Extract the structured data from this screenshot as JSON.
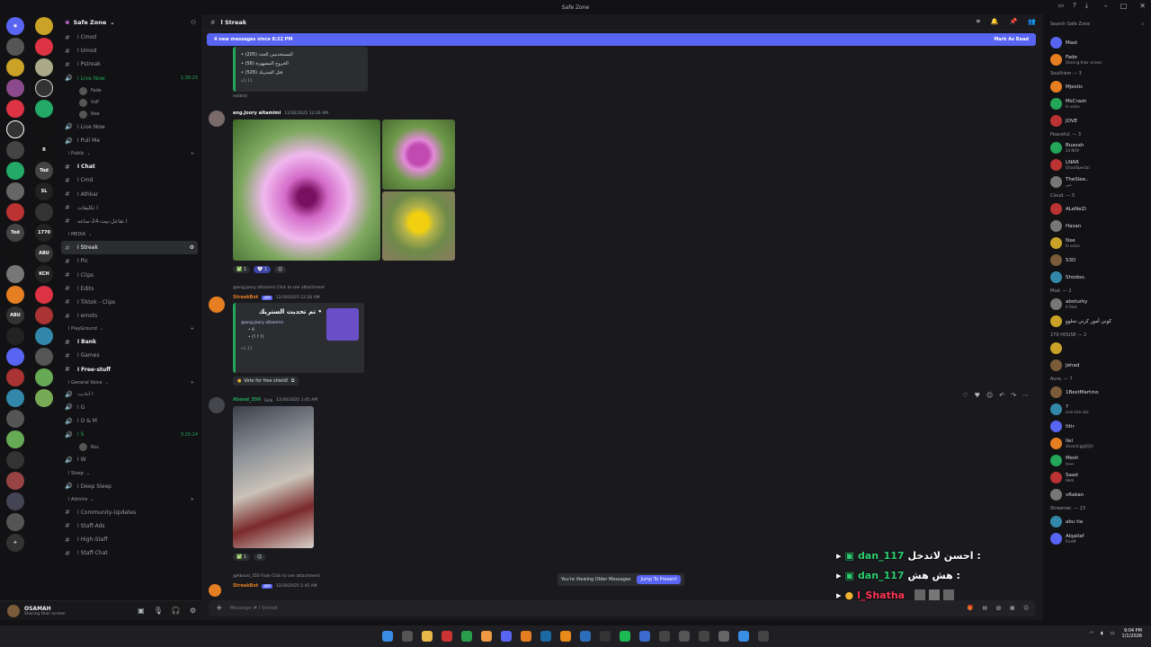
{
  "app": {
    "title": "Safe Zone"
  },
  "server": {
    "name": "Safe Zone"
  },
  "channels": {
    "top": [
      {
        "label": "ا Cmod"
      },
      {
        "label": "ا Umod"
      },
      {
        "label": "ا Pstreak"
      }
    ],
    "live": {
      "label": "ا Live Now",
      "time": "1:38:25",
      "users": [
        {
          "name": "Fade"
        },
        {
          "name": "VsP"
        },
        {
          "name": "Nxe"
        }
      ]
    },
    "after_live": [
      {
        "label": "ا Live Now"
      },
      {
        "label": "ا Pull Me"
      }
    ],
    "public": {
      "label": "ا Public",
      "items": [
        {
          "label": "ا Chat"
        },
        {
          "label": "ا Cmd"
        },
        {
          "label": "ا Athkar"
        },
        {
          "label": "ا تكليفات"
        },
        {
          "label": "ا تفاعل-بيت-24-ساعه"
        }
      ]
    },
    "media": {
      "label": "ا MEDIA",
      "items": [
        {
          "label": "ا Streak"
        },
        {
          "label": "ا Pic"
        },
        {
          "label": "ا Clips"
        },
        {
          "label": "ا Edits"
        },
        {
          "label": "ا Tiktok - Clips"
        },
        {
          "label": "ا emots"
        }
      ]
    },
    "playground": {
      "label": "ا PlayGround",
      "items": [
        {
          "label": "ا Bank"
        },
        {
          "label": "ا Games"
        },
        {
          "label": "ا Free-stuff"
        }
      ]
    },
    "general_voice": {
      "label": "ا General Voice",
      "items": [
        {
          "label": "ا آحاديث"
        },
        {
          "label": "ا G"
        },
        {
          "label": "ا O & M"
        },
        {
          "label": "ا S"
        },
        {
          "label": "ا W"
        }
      ],
      "s_time": "3:25:24",
      "s_user": "Ros"
    },
    "sleep": {
      "label": "ا Sleep",
      "items": [
        {
          "label": "ا Deep Sleep"
        }
      ]
    },
    "admins": {
      "label": "ا Admins",
      "items": [
        {
          "label": "ا Community-Updates"
        },
        {
          "label": "ا Staff-Ads"
        },
        {
          "label": "ا High-Staff"
        },
        {
          "label": "ا Staff-Chat"
        }
      ]
    }
  },
  "user": {
    "name": "OSAMAH",
    "status": "Sharing their screen"
  },
  "header": {
    "channel": "ا Streak"
  },
  "banner": {
    "text": "4 new messages since 8:22 PM",
    "action": "Mark As Read"
  },
  "messages": {
    "m0": {
      "lines": [
        "• (205) المستخدمين الجدد",
        "• (56) الخروج المشهورة",
        "• (526) قتل الستريك"
      ],
      "footer": "v1.11",
      "edited": "(edited)"
    },
    "m1": {
      "author": "eng.Joory altamimi",
      "time": "12/30/2025 12:26 AM",
      "reactions": [
        "✅ 1",
        "🤍 1"
      ]
    },
    "m2": {
      "reply": "@eng.Joory altamimi Click to see attachment",
      "author": "StreakBot",
      "badge": "APP",
      "time": "12/30/2025 12:26 AM",
      "embed_title": "تم تحديث الستريك •",
      "embed_user": "@eng.Joory altamimi",
      "embed_lines": [
        "• 6",
        "• (؟ ؟ ؟)"
      ],
      "embed_footer": "v1.11",
      "vote": "Vote for free shield!"
    },
    "m3": {
      "author": "Abood_350",
      "tag": "Fade",
      "time": "12/30/2025 1:45 AM",
      "reactions": [
        "✅ 1"
      ]
    },
    "m4": {
      "reply": "@Abood_350 Fade Click to see attachment",
      "author": "StreakBot",
      "badge": "APP",
      "time": "12/30/2025 1:45 AM"
    }
  },
  "older": {
    "text": "You're Viewing Older Messages",
    "button": "Jump To Present"
  },
  "composer": {
    "placeholder": "Message # ا Streak"
  },
  "overlay": [
    {
      "name": "dan_117",
      "text": "احسن لاتدخل :"
    },
    {
      "name": "dan_117",
      "text": "هش هش :"
    },
    {
      "name": "l_Shatha",
      "text": ""
    }
  ],
  "members": {
    "search": "Search Safe Zone",
    "groups": [
      {
        "label": "",
        "members": [
          {
            "name": "Mast",
            "sub": ""
          },
          {
            "name": "Fade",
            "sub": "Sharing their screen"
          }
        ]
      },
      {
        "label": "Southism — 3",
        "members": [
          {
            "name": "Mjestic",
            "sub": ""
          },
          {
            "name": "MsCrash",
            "sub": "In voice"
          },
          {
            "name": "JOVE",
            "sub": ""
          }
        ]
      },
      {
        "label": "Peaceful. — 3",
        "members": [
          {
            "name": "Buasah",
            "sub": "24 NOV"
          },
          {
            "name": "LNAR",
            "sub": "GhostSpectal"
          },
          {
            "name": "TheSlee..",
            "sub": "حبي"
          }
        ]
      },
      {
        "label": "Cloud. — 5",
        "members": [
          {
            "name": "ALeNeZi",
            "sub": ""
          },
          {
            "name": "Hasan",
            "sub": ""
          },
          {
            "name": "Nxe",
            "sub": "In voice"
          },
          {
            "name": "S3D",
            "sub": ""
          },
          {
            "name": "Shodoo.",
            "sub": ""
          }
        ]
      },
      {
        "label": "Mod. — 2",
        "members": [
          {
            "name": "aboturky",
            "sub": "A Rest"
          },
          {
            "name": "كوني أمور كرني تحلوو",
            "sub": ""
          }
        ]
      },
      {
        "label": "279 HOUSE — 2",
        "members": [
          {
            "name": "",
            "sub": ""
          },
          {
            "name": "Jehad",
            "sub": ""
          }
        ]
      },
      {
        "label": "Aura. — 7",
        "members": [
          {
            "name": "1BestMartino",
            "sub": ""
          },
          {
            "name": "?",
            "sub": "Live kick.s/Ix"
          },
          {
            "name": "Ittir",
            "sub": ""
          },
          {
            "name": "Ilel",
            "sub": "discord.gg/JOJU"
          },
          {
            "name": "Mesh",
            "sub": "تسمح"
          },
          {
            "name": "Saad",
            "sub": "Hom"
          },
          {
            "name": "vRakan",
            "sub": ""
          }
        ]
      },
      {
        "label": "Streamer. — 13",
        "members": [
          {
            "name": "abu tia",
            "sub": ""
          },
          {
            "name": "Alqallaf",
            "sub": "FiveM"
          }
        ]
      }
    ]
  },
  "taskbar": {
    "time": "9:04 PM",
    "date": "1/1/2026"
  },
  "colors": {
    "accent": "#5865f2",
    "green": "#23a55a",
    "bg": "#1a1a1e"
  }
}
